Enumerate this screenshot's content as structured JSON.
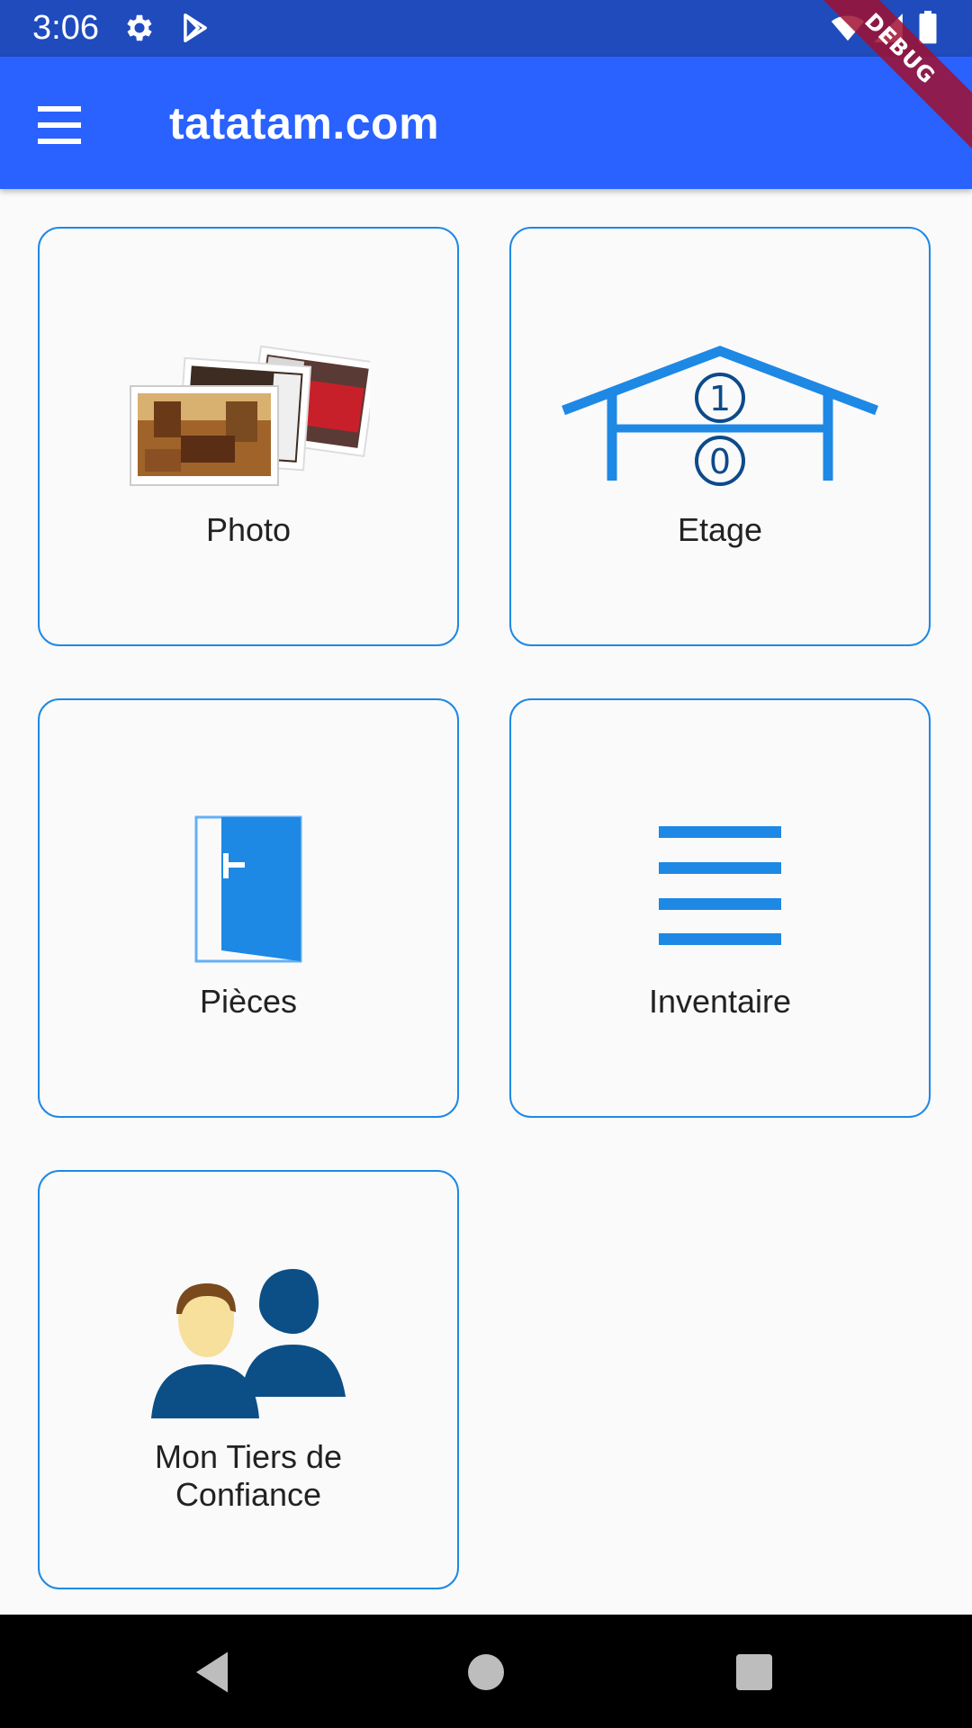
{
  "status_bar": {
    "time": "3:06",
    "icons": [
      "gear-icon",
      "play-store-icon",
      "wifi-icon",
      "signal-icon",
      "battery-icon"
    ]
  },
  "app_bar": {
    "title": "tatatam.com",
    "menu_icon": "hamburger-menu-icon",
    "color": "#2962ff"
  },
  "debug_banner": {
    "label": "DEBUG"
  },
  "tiles": [
    {
      "label": "Photo",
      "icon": "photos-icon"
    },
    {
      "label": "Etage",
      "icon": "floors-house-icon"
    },
    {
      "label": "Pièces",
      "icon": "door-icon"
    },
    {
      "label": "Inventaire",
      "icon": "list-icon"
    },
    {
      "label": "Mon Tiers de Confiance",
      "label_line1": "Mon Tiers de",
      "label_line2": "Confiance",
      "icon": "trusted-people-icon"
    }
  ],
  "nav_bar": {
    "buttons": [
      "back-icon",
      "home-icon",
      "recents-icon"
    ]
  },
  "colors": {
    "accent": "#1e88e5",
    "status_bar": "#1f4bbd",
    "debug": "#a01030"
  }
}
